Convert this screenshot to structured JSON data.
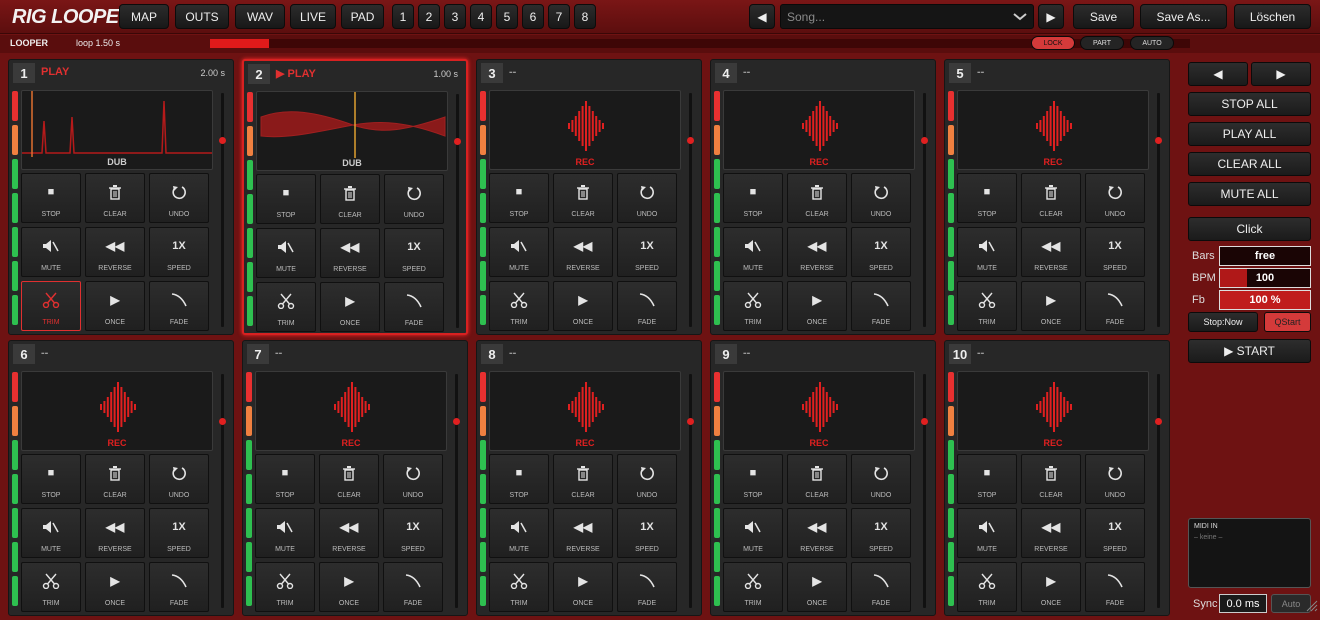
{
  "app_title": "RIG LOOPER",
  "top_nav": [
    "MAP",
    "OUTS",
    "WAV",
    "LIVE",
    "PAD"
  ],
  "bank_numbers": [
    "1",
    "2",
    "3",
    "4",
    "5",
    "6",
    "7",
    "8"
  ],
  "song": {
    "placeholder": "Song...",
    "save": "Save",
    "save_as": "Save As...",
    "delete": "Löschen"
  },
  "status": {
    "label": "LOOPER",
    "loop_info": "loop 1.50 s",
    "progress": 0.06,
    "lock": "LOCK",
    "part": "PART",
    "auto": "AUTO",
    "lock_active": true
  },
  "slots": [
    {
      "num": "1",
      "status": "PLAY",
      "duration": "2.00 s",
      "display": "DUB",
      "active_button": "TRIM",
      "selected": false,
      "playing_icon": false
    },
    {
      "num": "2",
      "status": "PLAY",
      "duration": "1.00 s",
      "display": "DUB",
      "active_button": "",
      "selected": true,
      "playing_icon": true
    },
    {
      "num": "3",
      "status": "--",
      "duration": "",
      "display": "REC"
    },
    {
      "num": "4",
      "status": "--",
      "duration": "",
      "display": "REC"
    },
    {
      "num": "5",
      "status": "--",
      "duration": "",
      "display": "REC"
    },
    {
      "num": "6",
      "status": "--",
      "duration": "",
      "display": "REC"
    },
    {
      "num": "7",
      "status": "--",
      "duration": "",
      "display": "REC"
    },
    {
      "num": "8",
      "status": "--",
      "duration": "",
      "display": "REC"
    },
    {
      "num": "9",
      "status": "--",
      "duration": "",
      "display": "REC"
    },
    {
      "num": "10",
      "status": "--",
      "duration": "",
      "display": "REC"
    }
  ],
  "slot_buttons": [
    {
      "label": "STOP",
      "icon": "stop-icon",
      "glyph": "■"
    },
    {
      "label": "CLEAR",
      "icon": "trash-icon",
      "glyph": ""
    },
    {
      "label": "UNDO",
      "icon": "undo-icon",
      "glyph": ""
    },
    {
      "label": "MUTE",
      "icon": "mute-icon",
      "glyph": ""
    },
    {
      "label": "REVERSE",
      "icon": "rewind-icon",
      "glyph": "◀◀"
    },
    {
      "label": "SPEED",
      "icon": "speed-icon",
      "glyph": "1X"
    },
    {
      "label": "TRIM",
      "icon": "scissors-icon",
      "glyph": ""
    },
    {
      "label": "ONCE",
      "icon": "play-once-icon",
      "glyph": "▶"
    },
    {
      "label": "FADE",
      "icon": "fade-icon",
      "glyph": ""
    }
  ],
  "sidebar": {
    "prev": "◀",
    "next": "▶",
    "actions": [
      "STOP ALL",
      "PLAY ALL",
      "CLEAR ALL",
      "MUTE ALL"
    ],
    "click": "Click",
    "fields": [
      {
        "label": "Bars",
        "value": "free",
        "fill": 0
      },
      {
        "label": "BPM",
        "value": "100",
        "fill": 0.3
      },
      {
        "label": "Fb",
        "value": "100 %",
        "fill": 1.0
      }
    ],
    "stop_mode": "Stop:Now",
    "qstart": "QStart",
    "start": "▶ START",
    "midi_title": "MIDI IN",
    "midi_value": "– keine –",
    "sync_label": "Sync",
    "sync_value": "0.0 ms",
    "sync_auto": "Auto"
  },
  "colors": {
    "accent": "#e02020",
    "meter_red": "#e83030",
    "meter_orange": "#f08040",
    "meter_green": "#2ec050"
  }
}
